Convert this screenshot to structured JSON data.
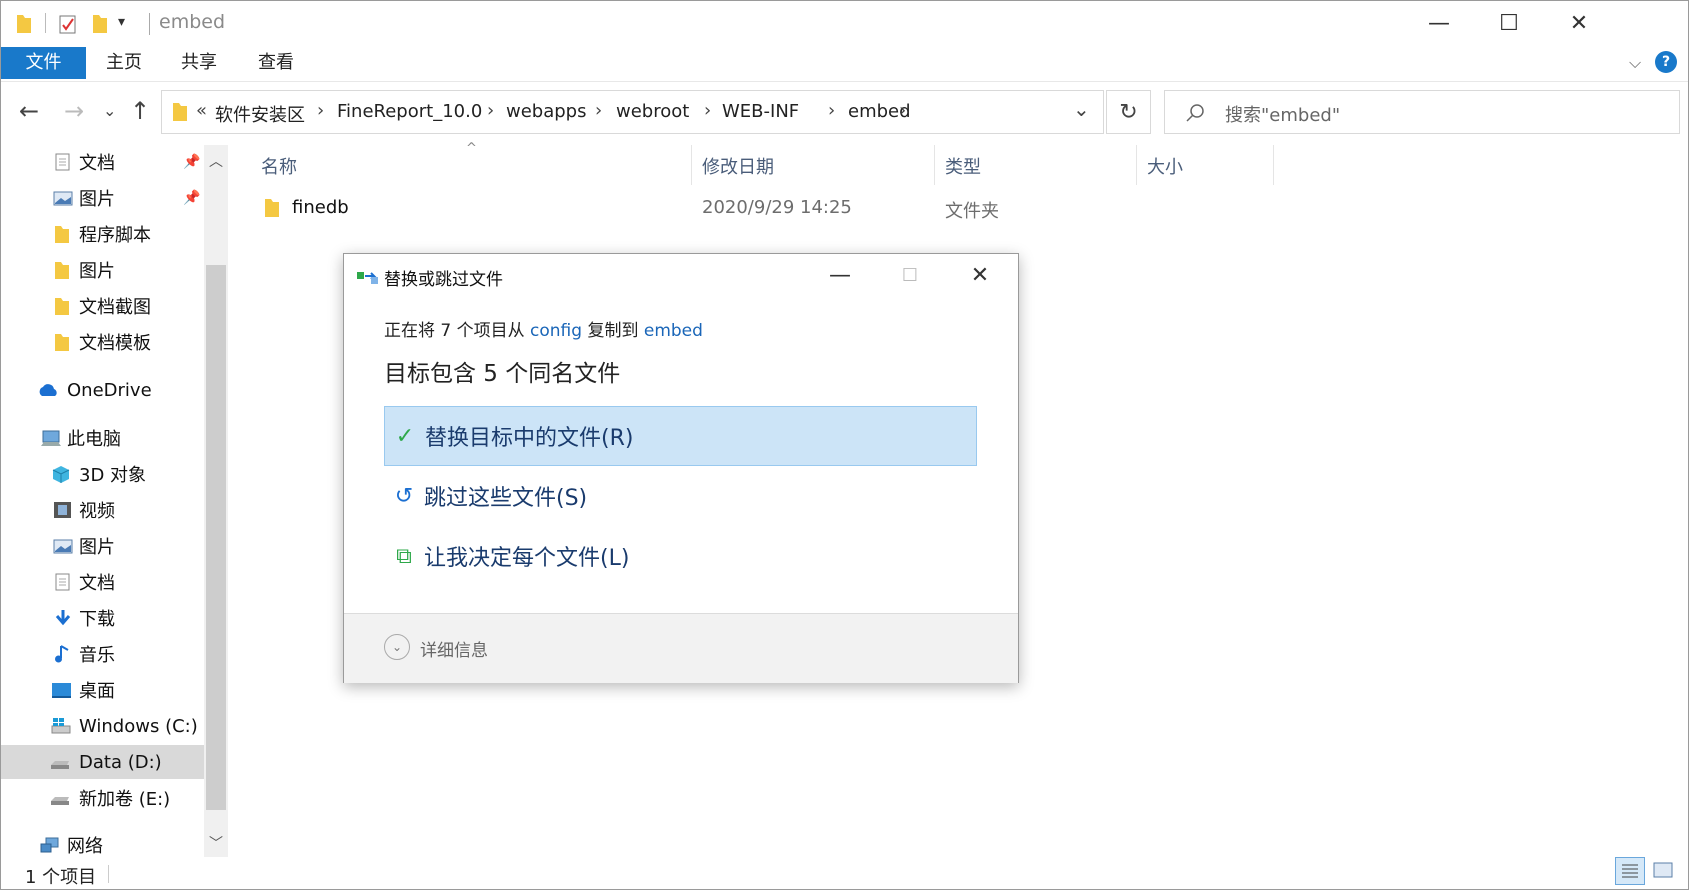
{
  "window": {
    "title": "embed",
    "quick_access_dropdown": "▾",
    "controls": {
      "minimize": "—",
      "maximize": "☐",
      "close": "✕"
    }
  },
  "ribbon": {
    "tabs": [
      "文件",
      "主页",
      "共享",
      "查看"
    ],
    "help": "?",
    "collapse": "⌵"
  },
  "nav": {
    "back": "←",
    "forward": "→",
    "recent": "⌄",
    "up": "↑"
  },
  "address": {
    "overflow": "«",
    "crumbs": [
      "软件安装区",
      "FineReport_10.0",
      "webapps",
      "webroot",
      "WEB-INF",
      "embed"
    ],
    "separator": "›",
    "dropdown": "⌄",
    "refresh": "↻"
  },
  "search": {
    "placeholder": "搜索\"embed\""
  },
  "sidebar": {
    "items": [
      {
        "label": "文档",
        "icon": "document-icon",
        "pinned": true
      },
      {
        "label": "图片",
        "icon": "picture-icon",
        "pinned": true
      },
      {
        "label": "程序脚本",
        "icon": "folder-icon"
      },
      {
        "label": "图片",
        "icon": "folder-icon"
      },
      {
        "label": "文档截图",
        "icon": "folder-icon"
      },
      {
        "label": "文档模板",
        "icon": "folder-icon"
      },
      {
        "label": "OneDrive",
        "icon": "cloud-icon"
      },
      {
        "label": "此电脑",
        "icon": "computer-icon"
      },
      {
        "label": "3D 对象",
        "icon": "cube-icon"
      },
      {
        "label": "视频",
        "icon": "video-icon"
      },
      {
        "label": "图片",
        "icon": "picture-icon"
      },
      {
        "label": "文档",
        "icon": "document-icon"
      },
      {
        "label": "下载",
        "icon": "download-icon"
      },
      {
        "label": "音乐",
        "icon": "music-icon"
      },
      {
        "label": "桌面",
        "icon": "desktop-icon"
      },
      {
        "label": "Windows (C:)",
        "icon": "windows-drive-icon"
      },
      {
        "label": "Data (D:)",
        "icon": "drive-icon",
        "selected": true
      },
      {
        "label": "新加卷 (E:)",
        "icon": "drive-icon"
      },
      {
        "label": "网络",
        "icon": "network-icon"
      }
    ],
    "pin_glyph": "📌"
  },
  "file_list": {
    "columns": [
      "名称",
      "修改日期",
      "类型",
      "大小"
    ],
    "sort_indicator": "^",
    "rows": [
      {
        "name": "finedb",
        "modified": "2020/9/29 14:25",
        "type": "文件夹",
        "size": ""
      }
    ]
  },
  "dialog": {
    "title": "替换或跳过文件",
    "controls": {
      "minimize": "—",
      "maximize": "☐",
      "close": "✕"
    },
    "line1_prefix": "正在将 7 个项目从 ",
    "line1_source": "config",
    "line1_mid": " 复制到 ",
    "line1_dest": "embed",
    "heading": "目标包含 5 个同名文件",
    "options": [
      {
        "label": "替换目标中的文件(R)",
        "icon": "checkmark-icon",
        "glyph": "✓",
        "selected": true
      },
      {
        "label": "跳过这些文件(S)",
        "icon": "undo-icon",
        "glyph": "↺"
      },
      {
        "label": "让我决定每个文件(L)",
        "icon": "compare-files-icon",
        "glyph": "⧉"
      }
    ],
    "details_label": "详细信息",
    "details_glyph": "⌄"
  },
  "status": {
    "item_count": "1 个项目"
  },
  "colors": {
    "accent": "#1979ca",
    "selected_option_bg": "#cce4f7",
    "link": "#1a66b8",
    "folder": "#f4c842"
  }
}
